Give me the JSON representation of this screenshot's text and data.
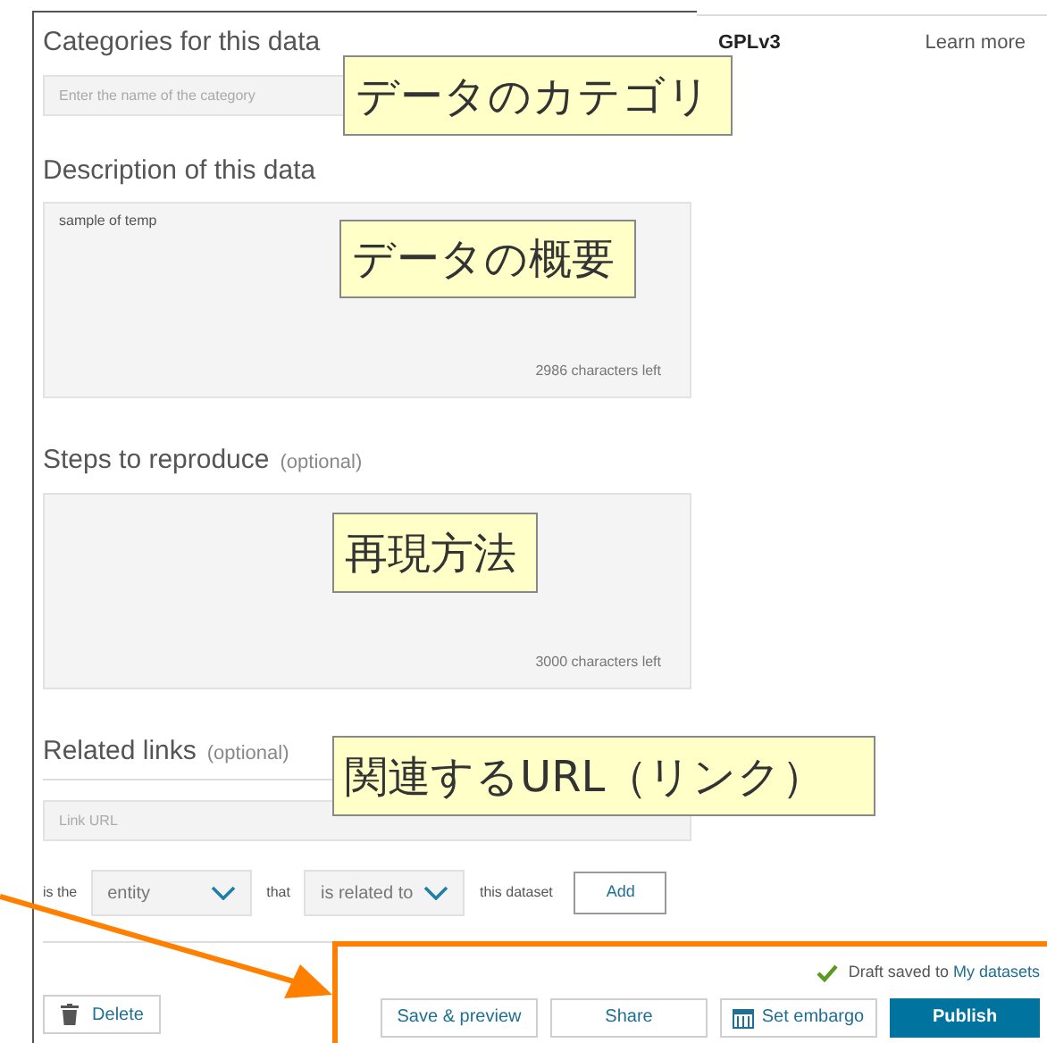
{
  "side_panel": {
    "license": "GPLv3",
    "link": "Learn more"
  },
  "categories": {
    "label": "Categories for this data",
    "placeholder": "Enter the name of the category"
  },
  "description": {
    "label": "Description of this data",
    "value": "sample of temp",
    "counter": "2986 characters left"
  },
  "steps": {
    "label": "Steps to reproduce",
    "optional": "(optional)",
    "counter": "3000 characters left"
  },
  "related_links": {
    "label": "Related links",
    "optional": "(optional)",
    "placeholder": "Link URL",
    "prefix": "is the",
    "entity": "entity",
    "connector": "that",
    "relation": "is related to",
    "suffix": "this dataset",
    "add": "Add"
  },
  "footer": {
    "delete": "Delete",
    "status": "Draft saved to",
    "status_link": "My datasets",
    "buttons": [
      {
        "label": "Save & preview",
        "kind": "outline"
      },
      {
        "label": "Share",
        "kind": "outline"
      },
      {
        "label": "Set embargo",
        "kind": "calendar"
      },
      {
        "label": "Publish",
        "kind": "primary"
      }
    ]
  },
  "callouts": [
    {
      "text": "データのカテゴリ"
    },
    {
      "text": "データの概要"
    },
    {
      "text": "再現方法"
    },
    {
      "text": "関連するURL（リンク）"
    }
  ]
}
